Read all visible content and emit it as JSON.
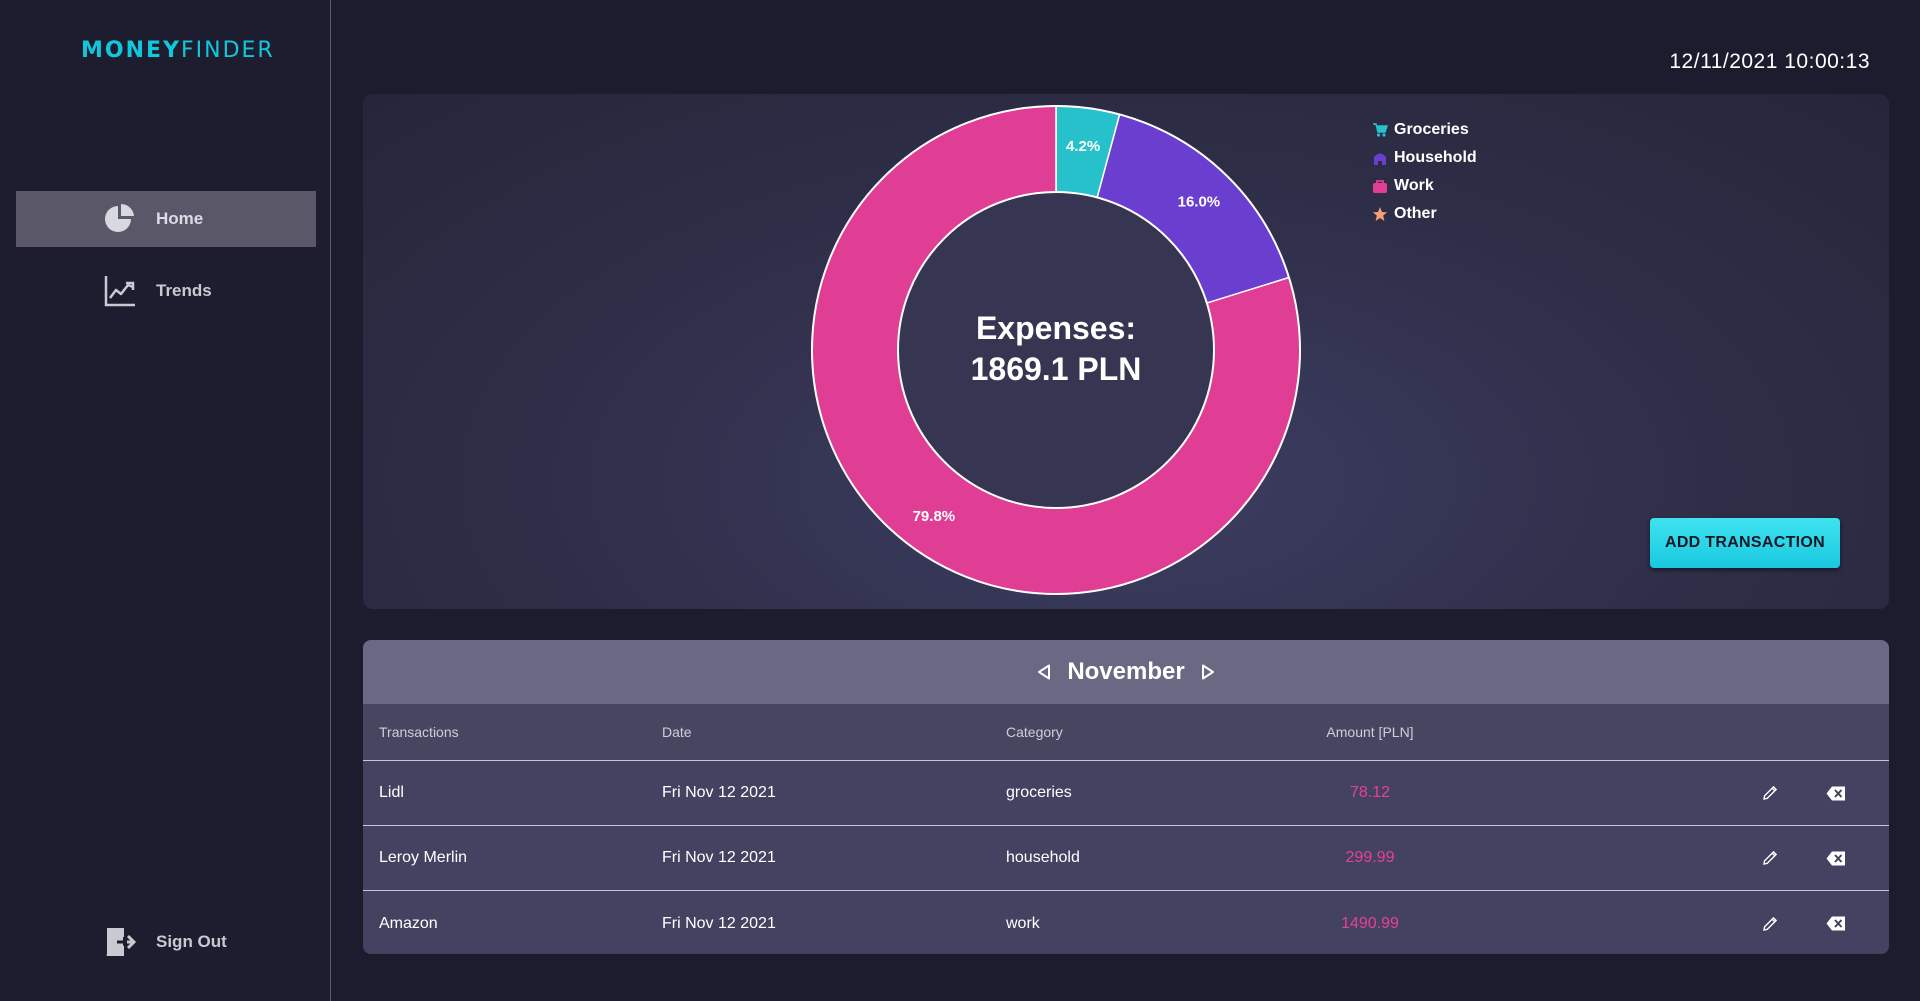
{
  "app": {
    "logo_bold": "MONEY",
    "logo_light": "FINDER",
    "datetime": "12/11/2021 10:00:13"
  },
  "sidebar": {
    "items": [
      {
        "label": "Home",
        "icon": "pie-chart-icon",
        "active": true
      },
      {
        "label": "Trends",
        "icon": "line-chart-icon",
        "active": false
      }
    ],
    "signout_label": "Sign Out",
    "signout_icon": "sign-out-icon"
  },
  "chart_data": {
    "type": "pie",
    "center_line1": "Expenses:",
    "center_line2": "1869.1 PLN",
    "categories": [
      "Groceries",
      "Household",
      "Work",
      "Other"
    ],
    "values": [
      4.2,
      16.0,
      79.8,
      0
    ],
    "labels": [
      "4.2%",
      "16.0%",
      "79.8%",
      ""
    ],
    "colors": [
      "#27c1cc",
      "#6a3fcf",
      "#e03d95",
      "#f4a074"
    ],
    "icons": [
      "cart-icon",
      "house-icon",
      "briefcase-icon",
      "star-icon"
    ],
    "legend_position": "top-right"
  },
  "actions": {
    "add_transaction_label": "ADD TRANSACTION"
  },
  "transactions": {
    "month": "November",
    "columns": [
      "Transactions",
      "Date",
      "Category",
      "Amount [PLN]"
    ],
    "rows": [
      {
        "name": "Lidl",
        "date": "Fri Nov 12 2021",
        "category": "groceries",
        "amount": "78.12"
      },
      {
        "name": "Leroy Merlin",
        "date": "Fri Nov 12 2021",
        "category": "household",
        "amount": "299.99"
      },
      {
        "name": "Amazon",
        "date": "Fri Nov 12 2021",
        "category": "work",
        "amount": "1490.99"
      }
    ]
  },
  "colors": {
    "accent": "#10c8dc",
    "amount": "#e8409a",
    "background": "#1d1c2e"
  }
}
